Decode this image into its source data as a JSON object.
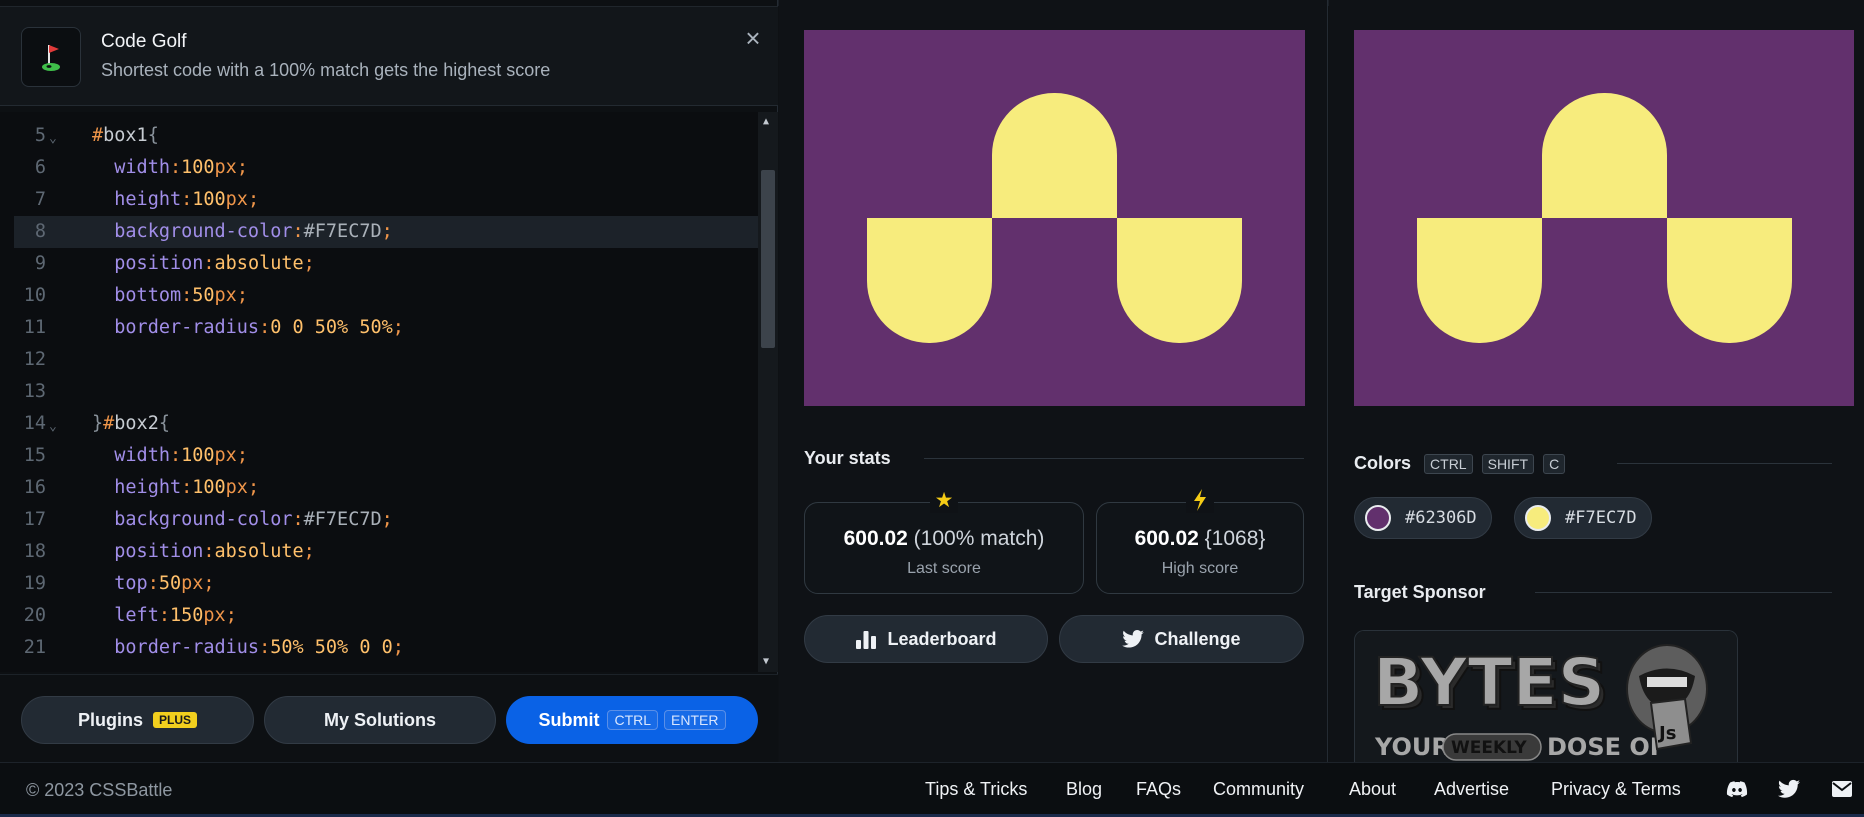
{
  "banner": {
    "title": "Code Golf",
    "subtitle": "Shortest code with a 100% match gets the highest score",
    "icon": "golf-flag-icon"
  },
  "editor": {
    "lines": [
      {
        "n": "5",
        "fold": true
      },
      {
        "n": "6"
      },
      {
        "n": "7"
      },
      {
        "n": "8",
        "active": true
      },
      {
        "n": "9"
      },
      {
        "n": "10"
      },
      {
        "n": "11"
      },
      {
        "n": "12"
      },
      {
        "n": "13"
      },
      {
        "n": "14",
        "fold": true
      },
      {
        "n": "15"
      },
      {
        "n": "16"
      },
      {
        "n": "17"
      },
      {
        "n": "18"
      },
      {
        "n": "19"
      },
      {
        "n": "20"
      },
      {
        "n": "21"
      }
    ],
    "code": {
      "l5_hash": "#",
      "l5_sel": "box1",
      "l5_brace": "{",
      "width_prop": "width",
      "colon": ":",
      "semi": ";",
      "px": "px",
      "v100": "100",
      "height_prop": "height",
      "bg_prop": "background-color",
      "hex_yellow": "#F7EC7D",
      "position_prop": "position",
      "absolute": "absolute",
      "bottom_prop": "bottom",
      "v50": "50",
      "radius_prop": "border-radius",
      "l11_val": "0 0 50% 50%",
      "l14_close": "}",
      "l14_hash": "#",
      "l14_sel": "box2",
      "l14_brace": "{",
      "top_prop": "top",
      "left_prop": "left",
      "v150": "150",
      "l21_val": "50% 50% 0 0"
    }
  },
  "buttons": {
    "plugins": "Plugins",
    "plugins_tag": "PLUS",
    "my_solutions": "My Solutions",
    "submit": "Submit",
    "submit_kbd1": "CTRL",
    "submit_kbd2": "ENTER"
  },
  "stats": {
    "title": "Your stats",
    "last_score": "600.02",
    "last_match": "(100% match)",
    "last_label": "Last score",
    "high_score": "600.02",
    "high_chars": "{1068}",
    "high_label": "High score",
    "leaderboard": "Leaderboard",
    "challenge": "Challenge"
  },
  "colors_section": {
    "title": "Colors",
    "kbd1": "CTRL",
    "kbd2": "SHIFT",
    "kbd3": "C",
    "swatches": [
      {
        "hex": "#62306D"
      },
      {
        "hex": "#F7EC7D"
      }
    ]
  },
  "sponsor": {
    "title": "Target Sponsor",
    "brand": "BYTES",
    "tagline_1": "YOUR",
    "tagline_2": "WEEKLY",
    "tagline_3": "DOSE OF",
    "badge": "Js"
  },
  "footer": {
    "copyright": "© 2023 CSSBattle",
    "links": [
      "Tips & Tricks",
      "Blog",
      "FAQs",
      "Community",
      "About",
      "Advertise",
      "Privacy & Terms"
    ]
  }
}
